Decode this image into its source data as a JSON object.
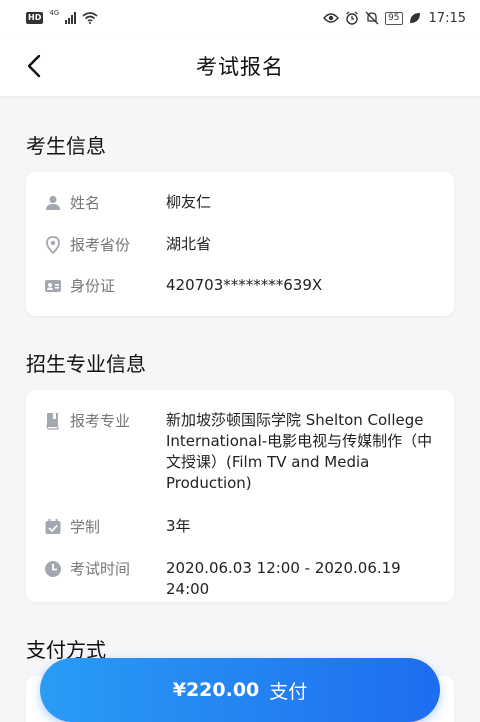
{
  "status_bar": {
    "hd": "HD",
    "network": "4G",
    "battery": "95",
    "time": "17:15"
  },
  "header": {
    "title": "考试报名"
  },
  "candidate": {
    "section_title": "考生信息",
    "name_label": "姓名",
    "name_value": "柳友仁",
    "province_label": "报考省份",
    "province_value": "湖北省",
    "id_label": "身份证",
    "id_value": "420703********639X"
  },
  "program": {
    "section_title": "招生专业信息",
    "major_label": "报考专业",
    "major_value": "新加坡莎顿国际学院 Shelton College International-电影电视与传媒制作（中文授课）(Film TV and Media Production)",
    "duration_label": "学制",
    "duration_value": "3年",
    "exam_time_label": "考试时间",
    "exam_time_value": "2020.06.03 12:00 - 2020.06.19 24:00"
  },
  "payment": {
    "section_title": "支付方式",
    "amount": "¥220.00",
    "pay_label": "支付"
  },
  "colors": {
    "accent": "#1e6df0",
    "icon_gray": "#a3a8b0"
  }
}
